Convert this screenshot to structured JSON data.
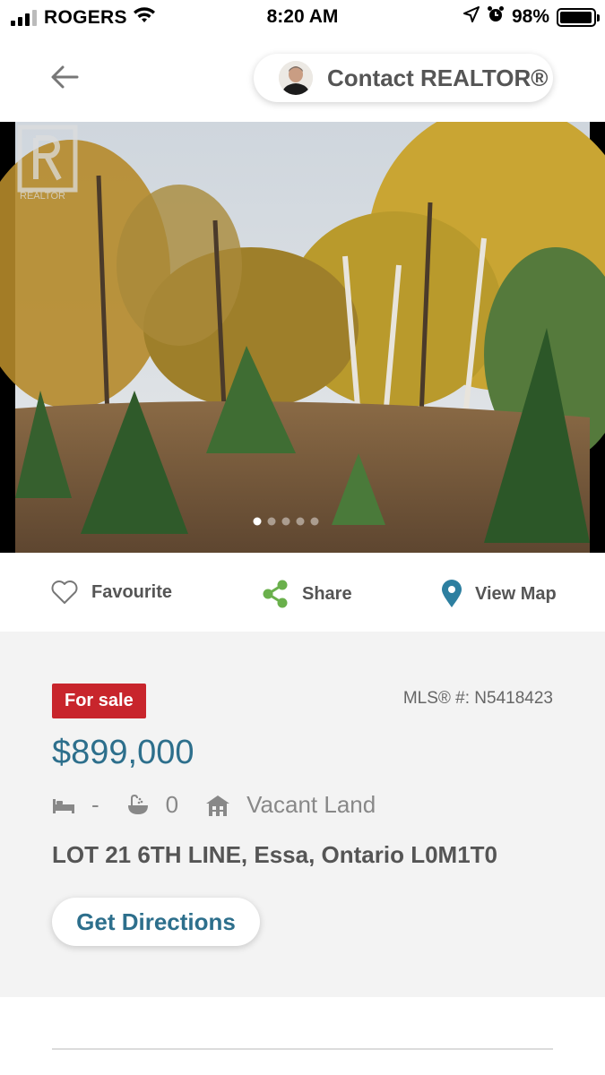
{
  "status_bar": {
    "carrier": "ROGERS",
    "time": "8:20 AM",
    "battery": "98%",
    "battery_level": 0.98,
    "icons": [
      "signal-icon",
      "wifi-icon",
      "location-arrow-icon",
      "alarm-icon",
      "battery-icon"
    ]
  },
  "header": {
    "back_icon": "arrow-left-icon",
    "contact_label": "Contact REALTOR®"
  },
  "photo": {
    "watermark": "REALTOR",
    "carousel_dots": 5,
    "active_dot": 0
  },
  "actions": {
    "favourite": "Favourite",
    "share": "Share",
    "view_map": "View Map"
  },
  "listing": {
    "status": "For sale",
    "mls": "MLS® #: N5418423",
    "price": "$899,000",
    "bedrooms": "-",
    "bathrooms": "0",
    "property_type": "Vacant Land",
    "address": "LOT 21 6TH  LINE, Essa, Ontario L0M1T0",
    "directions_label": "Get Directions"
  },
  "colors": {
    "accent_blue": "#2d6f8c",
    "sale_red": "#c8252c",
    "share_green": "#6ab04c",
    "map_blue": "#2d7fa0"
  }
}
